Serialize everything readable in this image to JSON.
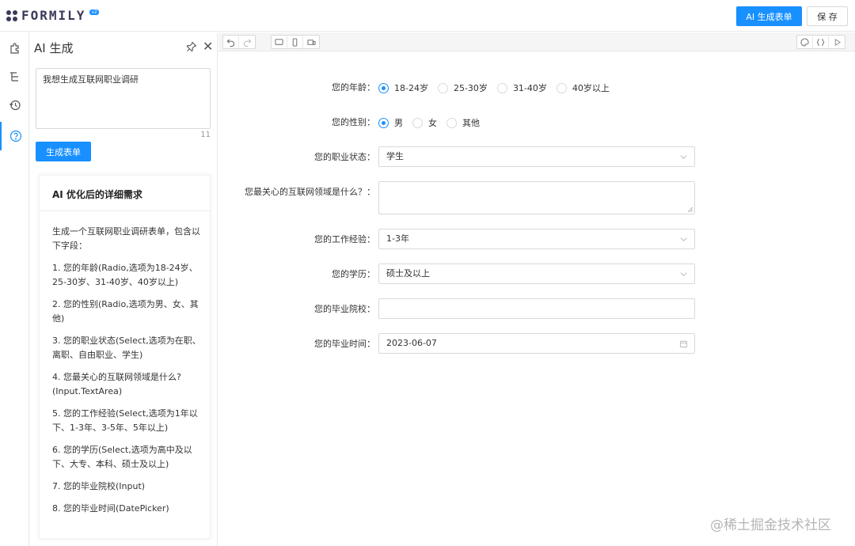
{
  "header": {
    "logo_text": "FORMILY",
    "logo_version": "v2",
    "ai_button": "AI 生成表单",
    "save_button": "保 存"
  },
  "rail": {
    "items": [
      {
        "icon": "puzzle-icon"
      },
      {
        "icon": "outline-tree-icon"
      },
      {
        "icon": "history-icon"
      },
      {
        "icon": "help-circle-icon",
        "active": true
      }
    ]
  },
  "panel": {
    "title": "AI 生成",
    "prompt_value": "我想生成互联网职业调研",
    "char_count": "11",
    "generate_button": "生成表单",
    "card_title": "AI 优化后的详细需求",
    "card_lines": [
      "生成一个互联网职业调研表单，包含以下字段：",
      "1. 您的年龄(Radio,选项为18-24岁、25-30岁、31-40岁、40岁以上)",
      "2. 您的性别(Radio,选项为男、女、其他)",
      "3. 您的职业状态(Select,选项为在职、离职、自由职业、学生)",
      "4. 您最关心的互联网领域是什么?(Input.TextArea)",
      "5. 您的工作经验(Select,选项为1年以下、1-3年、3-5年、5年以上)",
      "6. 您的学历(Select,选项为高中及以下、大专、本科、硕士及以上)",
      "7. 您的毕业院校(Input)",
      "8. 您的毕业时间(DatePicker)"
    ]
  },
  "form": {
    "age": {
      "label": "您的年龄：",
      "options": [
        "18-24岁",
        "25-30岁",
        "31-40岁",
        "40岁以上"
      ],
      "selected": 0
    },
    "gender": {
      "label": "您的性别：",
      "options": [
        "男",
        "女",
        "其他"
      ],
      "selected": 0
    },
    "job_status": {
      "label": "您的职业状态：",
      "value": "学生"
    },
    "interest": {
      "label": "您最关心的互联网领域是什么？：",
      "value": ""
    },
    "experience": {
      "label": "您的工作经验：",
      "value": "1-3年"
    },
    "education": {
      "label": "您的学历：",
      "value": "硕士及以上"
    },
    "school": {
      "label": "您的毕业院校：",
      "value": ""
    },
    "grad_date": {
      "label": "您的毕业时间：",
      "value": "2023-06-07"
    }
  },
  "watermark": "@稀土掘金技术社区",
  "colors": {
    "primary": "#1890ff",
    "border": "#d9d9d9"
  }
}
